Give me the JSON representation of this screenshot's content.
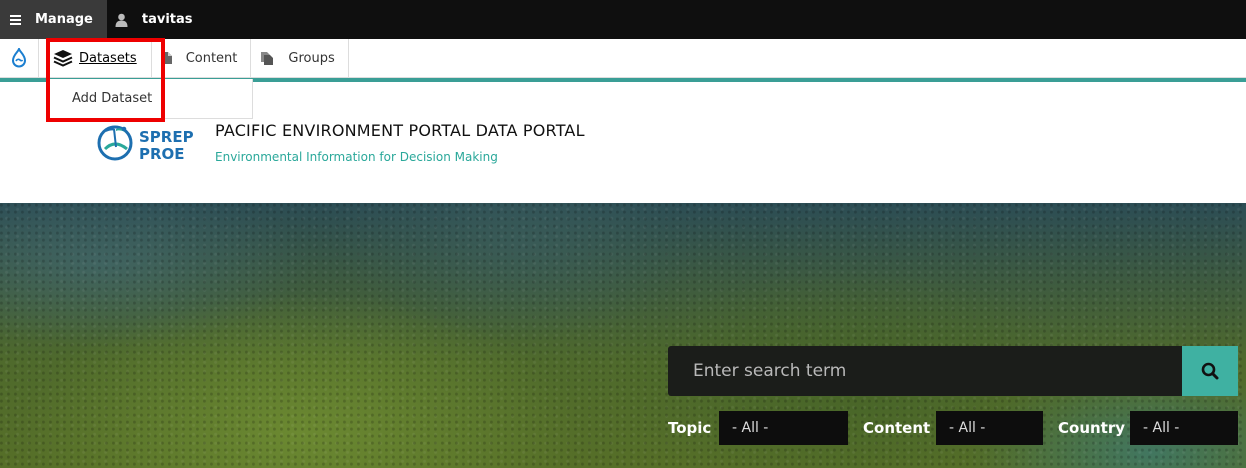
{
  "admin_bar": {
    "manage_label": "Manage",
    "user_label": "tavitas"
  },
  "tray": {
    "items": [
      {
        "label": "Datasets",
        "icon": "layers-icon"
      },
      {
        "label": "Content",
        "icon": "file-icon"
      },
      {
        "label": "Groups",
        "icon": "files-icon"
      }
    ],
    "submenu": {
      "add_dataset_label": "Add Dataset"
    }
  },
  "header": {
    "logo_text_line1": "SPREP",
    "logo_text_line2": "PROE",
    "site_name": "PACIFIC ENVIRONMENT PORTAL DATA PORTAL",
    "slogan": "Environmental Information for Decision Making"
  },
  "search": {
    "placeholder": "Enter search term"
  },
  "filters": [
    {
      "label": "Topic",
      "value": "- All -"
    },
    {
      "label": "Content",
      "value": "- All -"
    },
    {
      "label": "Country",
      "value": "- All -"
    }
  ],
  "colors": {
    "accent_teal": "#3fb1a2",
    "highlight_red": "#e00000"
  }
}
